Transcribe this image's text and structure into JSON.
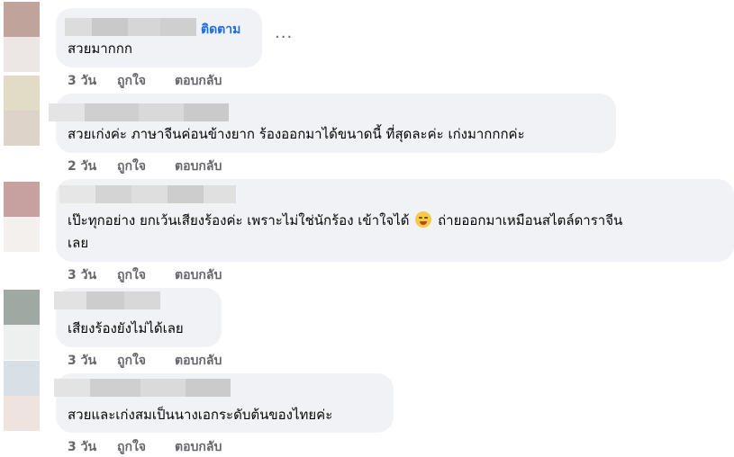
{
  "comments": [
    {
      "text": "สวยมากกก",
      "follow_label": "ติดตาม",
      "more_label": "...",
      "time": "3 วัน",
      "like": "ถูกใจ",
      "reply": "ตอบกลับ",
      "avatar_colors": [
        "#c0a39a",
        "#ece7e4"
      ],
      "name_blur_colors": [
        "#dcdcdc",
        "#c9c9c9",
        "#d6d6d6",
        "#cfcfcf"
      ]
    },
    {
      "text": "สวยเก่งค่ะ ภาษาจีนค่อนข้างยาก ร้องออกมาได้ขนาดนี้ ที่สุดละค่ะ เก่งมากกกค่ะ",
      "time": "2 วัน",
      "like": "ถูกใจ",
      "reply": "ตอบกลับ",
      "avatar_colors": [
        "#e0dcc6",
        "#ddd3c8"
      ],
      "name_blur_colors": [
        "#e4e4e4",
        "#cfcfcf",
        "#d9d9d9",
        "#cacaca"
      ]
    },
    {
      "text_line1": "เป๊ะทุกอย่าง ยกเว้นเสียงร้องค่ะ เพราะไม่ใช่นักร้อง เข้าใจได้",
      "emoji_name": "hugging-face",
      "text_line1b": "ถ่ายออกมาเหมือนสไตล์ดาราจีน",
      "text_line2": "เลย",
      "time": "3 วัน",
      "like": "ถูกใจ",
      "reply": "ตอบกลับ",
      "avatar_colors": [
        "#c7a1a0",
        "#f3f0ee"
      ],
      "name_blur_colors": [
        "#e6e6e6",
        "#d4d4d4",
        "#dedede",
        "#cdcdcd",
        "#e0e0e0"
      ]
    },
    {
      "text": "เสียงร้องยังไม่ได้เลย",
      "time": "3 วัน",
      "like": "ถูกใจ",
      "reply": "ตอบกลับ",
      "avatar_colors": [
        "#a0a8a4",
        "#eef0ef"
      ],
      "name_blur_colors": [
        "#e2e2e2",
        "#cdcdcd",
        "#d8d8d8"
      ]
    },
    {
      "text": "สวยและเก่งสมเป็นนางเอกระดับต้นของไทยค่ะ",
      "time": "3 วัน",
      "like": "ถูกใจ",
      "reply": "ตอบกลับ",
      "avatar_colors": [
        "#d9dfe6",
        "#efe3df"
      ],
      "name_blur_colors": [
        "#e3e3e3",
        "#cfcfcf",
        "#dadada",
        "#cbcbcb"
      ]
    }
  ]
}
